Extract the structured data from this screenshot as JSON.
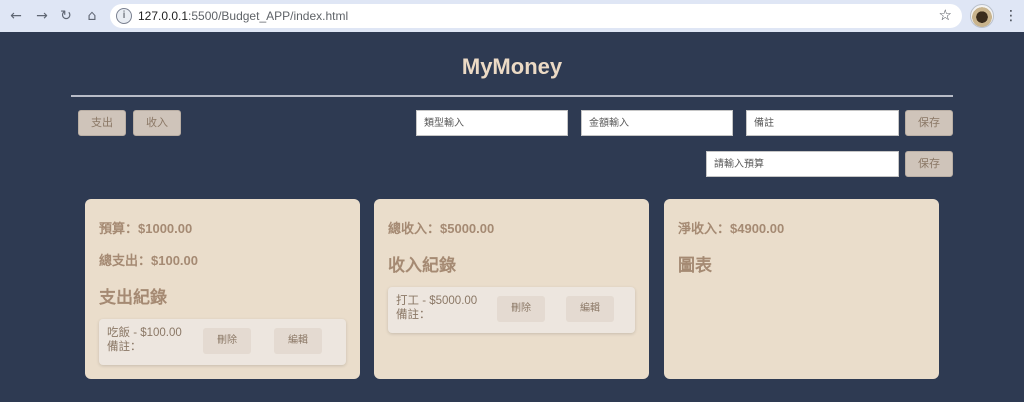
{
  "browser": {
    "url_host": "127.0.0.1",
    "url_rest": ":5500/Budget_APP/index.html",
    "icons": [
      "back-icon",
      "forward-icon",
      "reload-icon",
      "home-icon",
      "info-icon",
      "star-icon",
      "menu-icon"
    ]
  },
  "app": {
    "title": "MyMoney"
  },
  "controls": {
    "expense_tab": "支出",
    "income_tab": "收入",
    "type_placeholder": "類型輸入",
    "amount_placeholder": "金額輸入",
    "note_placeholder": "備註",
    "save_label": "保存",
    "budget_placeholder": "請輸入預算",
    "budget_save_label": "保存"
  },
  "expense_card": {
    "budget": "預算：$1000.00",
    "total_expense": "總支出：$100.00",
    "heading": "支出紀錄",
    "records": [
      {
        "line1": "吃飯 - $100.00",
        "line2": "備註：",
        "delete": "刪除",
        "edit": "編輯"
      }
    ]
  },
  "income_card": {
    "total_income": "總收入：$5000.00",
    "heading": "收入紀錄",
    "records": [
      {
        "line1": "打工 - $5000.00",
        "line2": "備註：",
        "delete": "刪除",
        "edit": "編輯"
      }
    ]
  },
  "net_card": {
    "net_income": "淨收入：$4900.00",
    "heading": "圖表"
  },
  "colors": {
    "background": "#2e3a52",
    "card": "#eaddcb",
    "accent_text": "#a58a73",
    "title": "#ecdac5"
  }
}
